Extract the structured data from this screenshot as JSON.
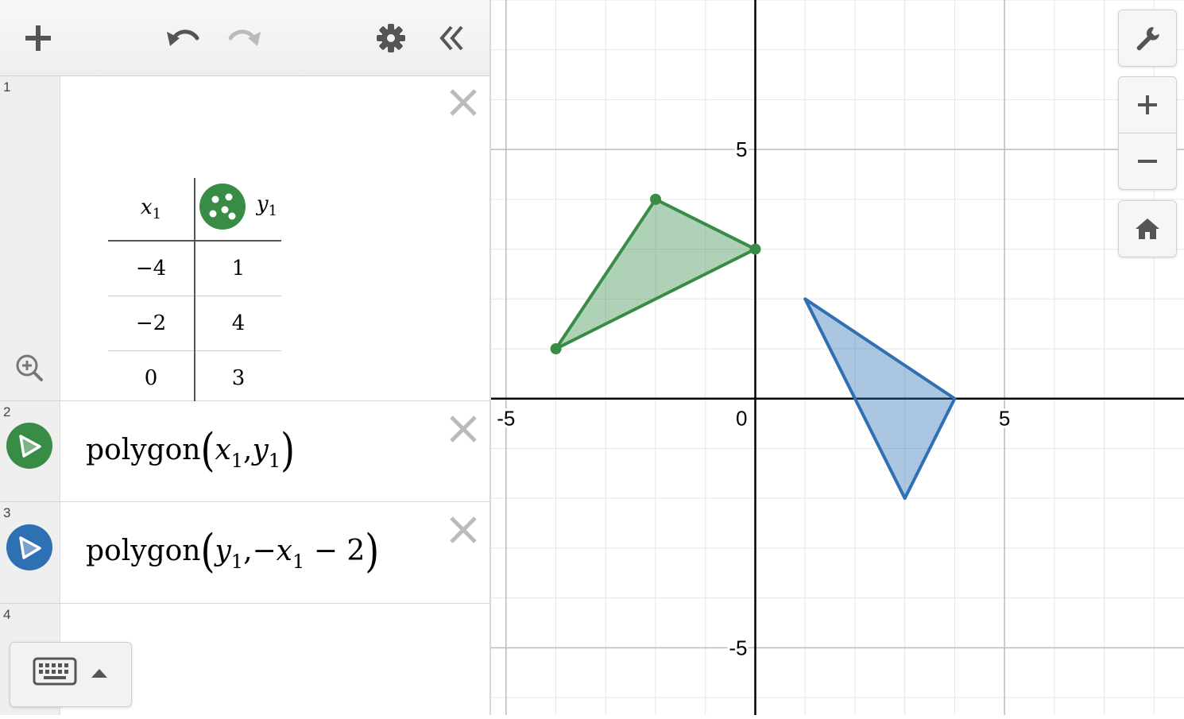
{
  "expressions": [
    {
      "index": "1",
      "type": "table",
      "headers": {
        "x": "x",
        "x_sub": "1",
        "y": "y",
        "y_sub": "1"
      },
      "rows": [
        {
          "x": "−4",
          "y": "1"
        },
        {
          "x": "−2",
          "y": "4"
        },
        {
          "x": "0",
          "y": "3"
        }
      ],
      "color": "#388c46"
    },
    {
      "index": "2",
      "type": "polygon",
      "func": "polygon",
      "arg1": "x",
      "arg1_sub": "1",
      "sep": ",",
      "arg2": "y",
      "arg2_sub": "1",
      "color": "#388c46"
    },
    {
      "index": "3",
      "type": "polygon",
      "func": "polygon",
      "arg1": "y",
      "arg1_sub": "1",
      "sep": ",−",
      "arg2": "x",
      "arg2_sub": "1",
      "tail": " − 2",
      "color": "#2d70b3"
    },
    {
      "index": "4",
      "type": "empty"
    }
  ],
  "graph": {
    "x_range": [
      -5.3,
      8.6
    ],
    "y_range": [
      -6.35,
      8.0
    ],
    "grid_step": 1,
    "label_step": 5,
    "x_tick_labels": [
      "-5",
      "0",
      "5"
    ],
    "y_tick_labels": [
      "5",
      "-5"
    ],
    "polygons": [
      {
        "name": "green-triangle",
        "points": [
          [
            -4,
            1
          ],
          [
            -2,
            4
          ],
          [
            0,
            3
          ]
        ],
        "color": "#388c46",
        "show_points": true
      },
      {
        "name": "blue-triangle",
        "points": [
          [
            1,
            2
          ],
          [
            4,
            0
          ],
          [
            3,
            -2
          ]
        ],
        "color": "#2d70b3",
        "show_points": false
      }
    ]
  },
  "colors": {
    "green": "#388c46",
    "blue": "#2d70b3",
    "axis": "#000000",
    "grid_minor": "#e6e6e6",
    "grid_major": "#bbbbbb"
  },
  "icons": {
    "toolbar": [
      "plus-icon",
      "undo-icon",
      "redo-icon",
      "gear-icon",
      "collapse-chevron-icon"
    ],
    "graph_controls": [
      "wrench-icon",
      "zoom-in-icon",
      "zoom-out-icon",
      "home-icon"
    ]
  }
}
